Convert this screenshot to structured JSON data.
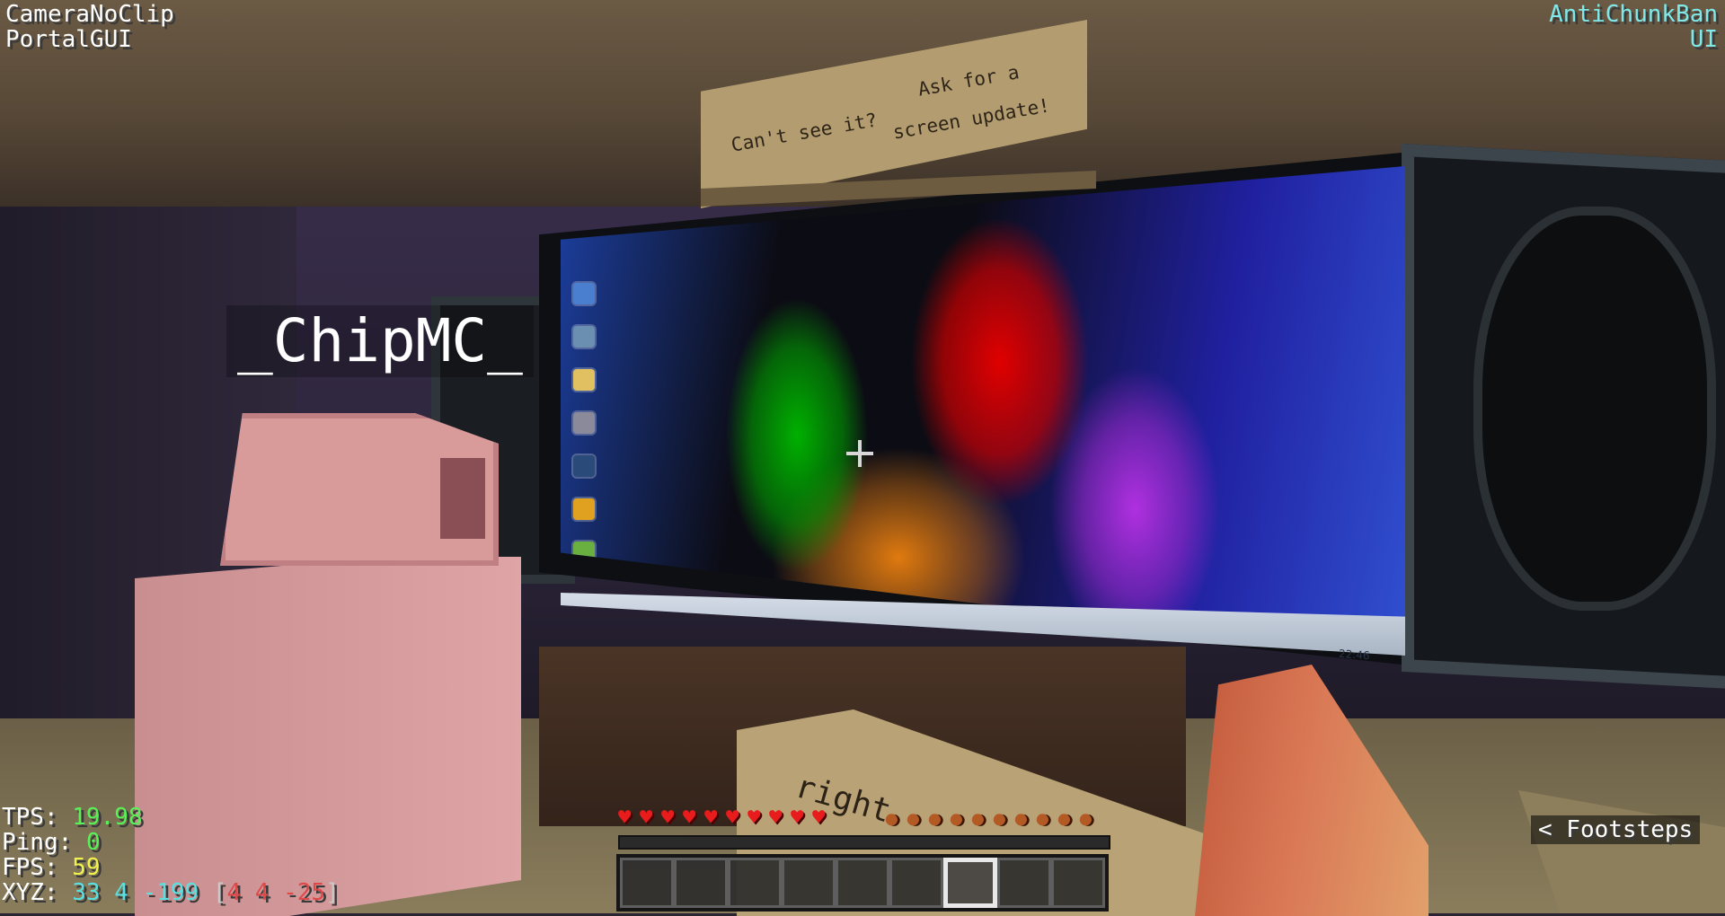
{
  "mods_left": [
    "CameraNoClip",
    "PortalGUI"
  ],
  "mods_right": [
    "AntiChunkBan",
    "UI"
  ],
  "sign": {
    "line1": "Can't see it?",
    "line2": "Ask for a",
    "line3": "screen update!"
  },
  "nametag": "_ChipMC_",
  "floor_sign_text": "right",
  "taskbar_clock": "22:46",
  "stats": {
    "tps_label": "TPS:",
    "tps_value": "19.98",
    "ping_label": "Ping:",
    "ping_value": "0",
    "fps_label": "FPS:",
    "fps_value": "59",
    "xyz_label": "XYZ:",
    "xyz_value": "33 4 -199",
    "nether_open": "[",
    "nether_value": "4 4 -25",
    "nether_close": "]"
  },
  "health_hearts": 10,
  "hunger_drumsticks": 10,
  "hotbar_slots": 9,
  "hotbar_selected": 6,
  "footsteps_label": "< Footsteps",
  "icons": {
    "heart": "heart-icon",
    "hunger": "drumstick-icon",
    "crosshair": "crosshair-icon"
  },
  "colors": {
    "tps": "#58f258",
    "fps": "#f2f24e",
    "xyz": "#5ae0e0",
    "nether": "#e04848",
    "mods_right": "#7fe8e8"
  }
}
